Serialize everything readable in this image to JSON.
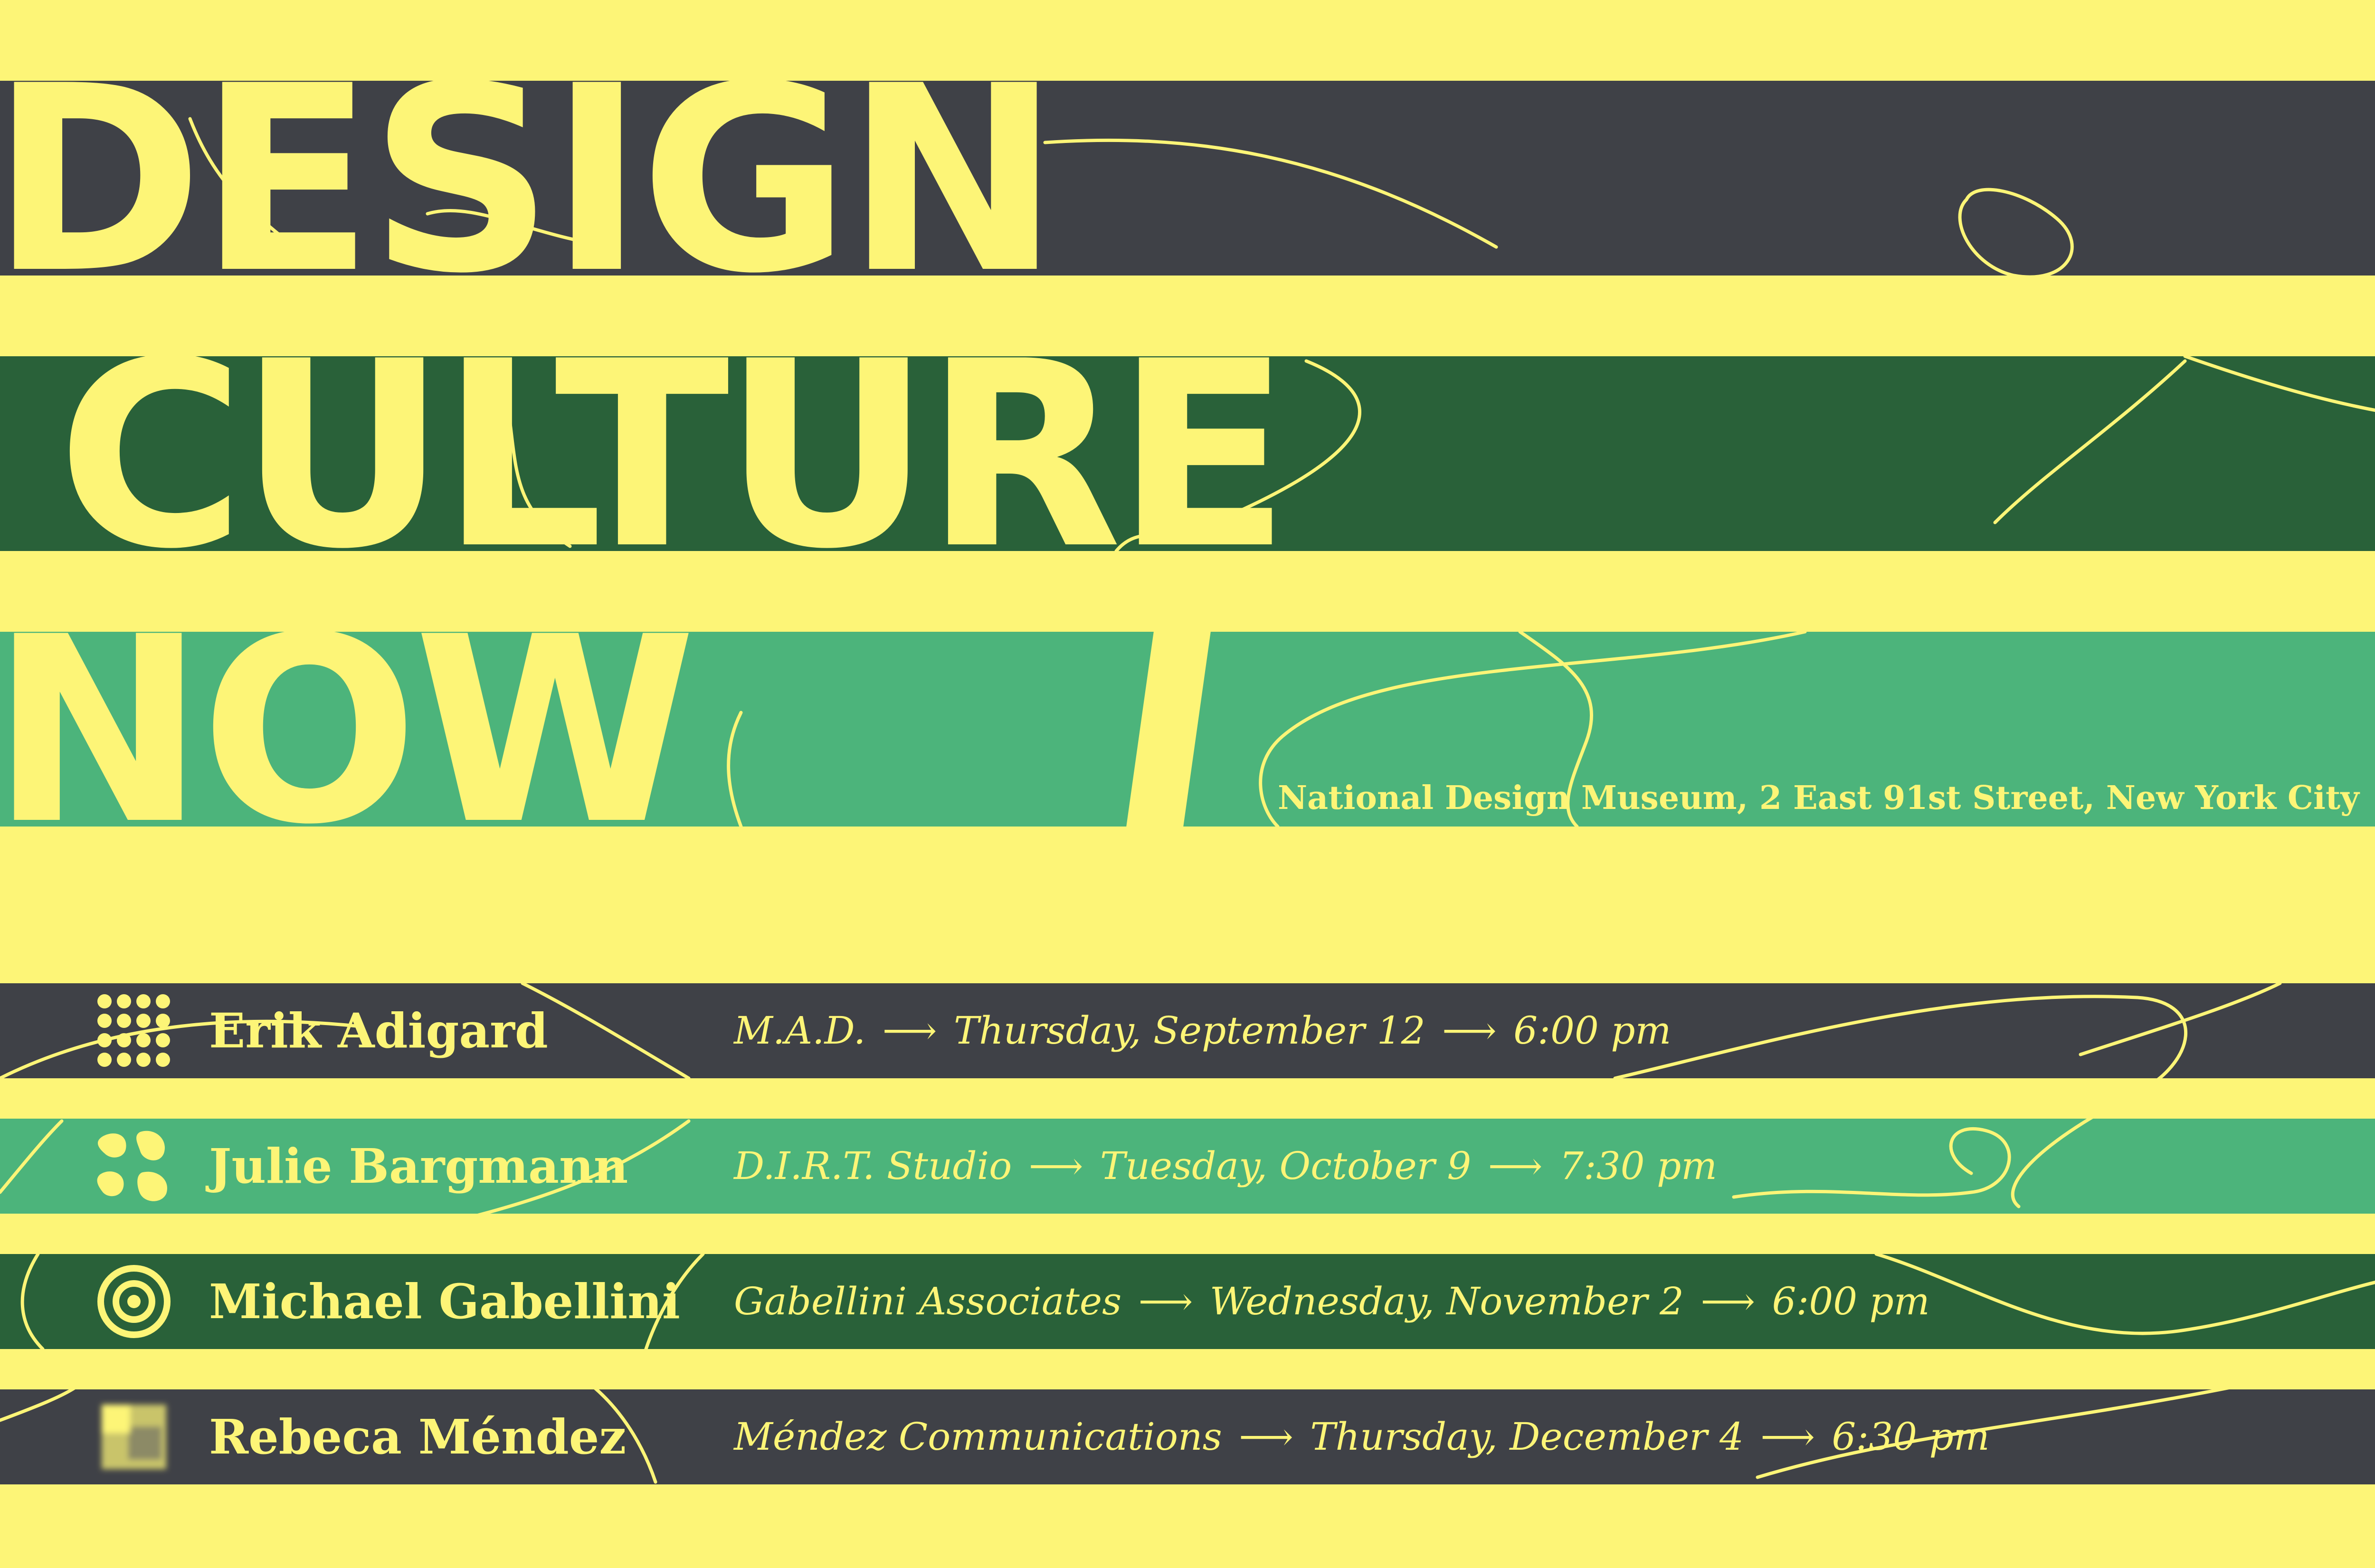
{
  "colors": {
    "background": "#fdf577",
    "charcoal": "#3f4147",
    "dark_green": "#296139",
    "light_green": "#4cb47b",
    "text": "#fdf577"
  },
  "title": {
    "line1": "DESIGN",
    "line2": "CULTURE",
    "line3": "NOW"
  },
  "venue": "National Design Museum, 2 East 91st Street, New York City",
  "arrow": "⟶",
  "events": [
    {
      "icon": "dot-grid-icon",
      "name": "Erik Adigard",
      "org": "M.A.D.",
      "date": "Thursday, September 12",
      "time": "6:00 pm",
      "band_color": "#3f4147"
    },
    {
      "icon": "organic-shapes-icon",
      "name": "Julie Bargmann",
      "org": "D.I.R.T. Studio",
      "date": "Tuesday, October 9",
      "time": "7:30 pm",
      "band_color": "#4cb47b"
    },
    {
      "icon": "concentric-circles-icon",
      "name": "Michael Gabellini",
      "org": "Gabellini Associates",
      "date": "Wednesday, November 2",
      "time": "6:00 pm",
      "band_color": "#296139"
    },
    {
      "icon": "blurred-square-icon",
      "name": "Rebeca Méndez",
      "org": "Méndez Communications",
      "date": "Thursday, December 4",
      "time": "6:30 pm",
      "band_color": "#3f4147"
    }
  ]
}
